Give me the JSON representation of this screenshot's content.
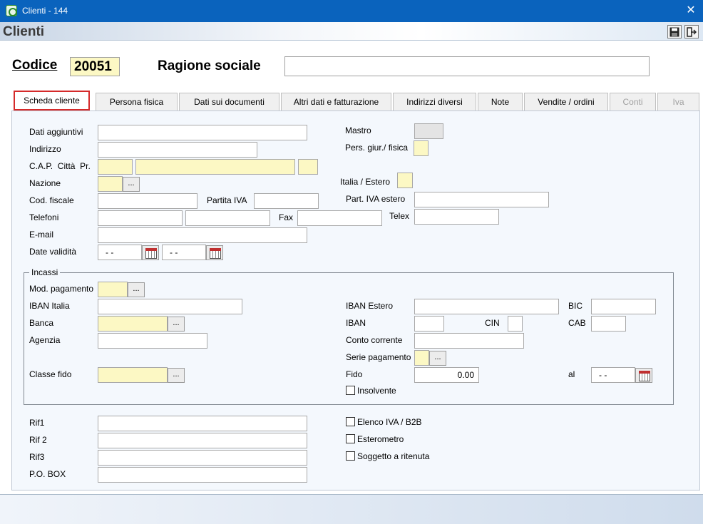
{
  "window": {
    "title": "Clienti - 144",
    "close_glyph": "✕"
  },
  "form": {
    "title": "Clienti"
  },
  "header": {
    "codice_label": "Codice",
    "codice_value": "20051",
    "ragione_sociale_label": "Ragione sociale",
    "ragione_sociale_value": ""
  },
  "tabs": [
    {
      "label": "Scheda cliente",
      "state": "active"
    },
    {
      "label": "Persona fisica",
      "state": "normal"
    },
    {
      "label": "Dati sui documenti",
      "state": "normal"
    },
    {
      "label": "Altri dati e fatturazione",
      "state": "normal"
    },
    {
      "label": "Indirizzi diversi",
      "state": "normal"
    },
    {
      "label": "Note",
      "state": "normal"
    },
    {
      "label": "Vendite / ordini",
      "state": "normal"
    },
    {
      "label": "Conti",
      "state": "disabled"
    },
    {
      "label": "Iva",
      "state": "disabled"
    }
  ],
  "labels": {
    "dati_aggiuntivi": "Dati aggiuntivi",
    "indirizzo": "Indirizzo",
    "cap_citta_pr": "C.A.P.  Città  Pr.",
    "nazione": "Nazione",
    "cod_fiscale": "Cod. fiscale",
    "partita_iva": "Partita IVA",
    "telefoni": "Telefoni",
    "fax": "Fax",
    "telex": "Telex",
    "email": "E-mail",
    "date_validita": "Date validità",
    "mastro": "Mastro",
    "pers_giur_fisica": "Pers. giur./ fisica",
    "italia_estero": "Italia / Estero",
    "part_iva_estero": "Part. IVA estero",
    "incassi": "Incassi",
    "mod_pagamento": "Mod. pagamento",
    "iban_italia": "IBAN Italia",
    "banca": "Banca",
    "agenzia": "Agenzia",
    "classe_fido": "Classe fido",
    "iban_estero": "IBAN Estero",
    "bic": "BIC",
    "iban": "IBAN",
    "cin": "CIN",
    "cab": "CAB",
    "conto_corrente": "Conto corrente",
    "serie_pagamento": "Serie pagamento",
    "fido": "Fido",
    "al": "al",
    "insolvente": "Insolvente",
    "rif1": "Rif1",
    "rif2": "Rif 2",
    "rif3": "Rif3",
    "po_box": "P.O. BOX",
    "elenco_iva": "Elenco IVA / B2B",
    "esterometro": "Esterometro",
    "soggetto_ritenuta": "Soggetto a ritenuta"
  },
  "values": {
    "date_from": "- -",
    "date_to": "- -",
    "fido": "0.00",
    "fido_al": "- -",
    "dots": "..."
  },
  "checkboxes": {
    "insolvente": false,
    "elenco_iva": false,
    "esterometro": false,
    "soggetto_ritenuta": false
  },
  "colors": {
    "titlebar": "#0a63bd",
    "required_field": "#fcf8c4",
    "active_tab_border": "#d52a2a",
    "panel": "#f4f8fd"
  },
  "icons": {
    "save": "save-icon",
    "exit": "exit-icon",
    "calendar": "calendar-icon",
    "app": "app-logo-icon"
  }
}
